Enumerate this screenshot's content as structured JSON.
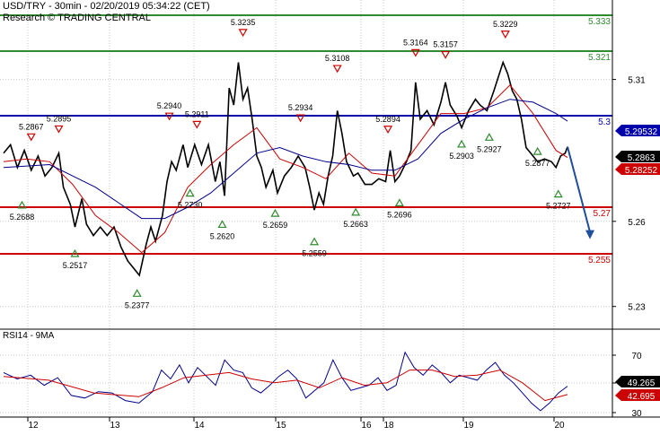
{
  "header": {
    "title": "USD/TRY - 30min - 02/20/2019 05:34:22 (CET)",
    "subtitle": "Research © TRADING CENTRAL"
  },
  "rsi_panel": {
    "title": "RSI14 - 9MA",
    "value": "49.265",
    "ma_value": "42.695",
    "ticks": [
      "70",
      "50",
      "30"
    ]
  },
  "colors": {
    "resistance": "#2e8b2e",
    "pivot": "#0000aa",
    "support": "#cc0000",
    "price": "#000000",
    "ma_fast": "#cc0000",
    "ma_slow": "#00008b",
    "arrow": "#1f4e9c",
    "price_tag": "#000000",
    "pivot_tag": "#0000aa",
    "ma_tag": "#cc0000",
    "rsi_tag": "#000000",
    "rsi_ma_tag": "#cc0000"
  },
  "chart_data": {
    "type": "line",
    "instrument": "USD/TRY",
    "timeframe": "30min",
    "y_axis_ticks": [
      "5.31",
      "5.26",
      "5.23"
    ],
    "ylim": [
      5.222,
      5.338
    ],
    "x_axis_ticks": [
      "12",
      "13",
      "14",
      "15",
      "16",
      "18",
      "19",
      "20"
    ],
    "levels": [
      {
        "kind": "resistance",
        "value": 5.333,
        "label": "5.333"
      },
      {
        "kind": "resistance",
        "value": 5.321,
        "label": "5.321"
      },
      {
        "kind": "pivot",
        "value": 5.3,
        "label": "5.3"
      },
      {
        "kind": "support",
        "value": 5.27,
        "label": "5.27"
      },
      {
        "kind": "support",
        "value": 5.255,
        "label": "5.255"
      }
    ],
    "price_tags": [
      {
        "kind": "pivot",
        "value": "5.29532"
      },
      {
        "kind": "price",
        "value": "5.2863"
      },
      {
        "kind": "ma",
        "value": "5.28252"
      }
    ],
    "annotations": [
      {
        "label": "5.2867",
        "type": "high",
        "x": 0.6,
        "value": 5.2867
      },
      {
        "label": "5.2895",
        "type": "high",
        "x": 1.2,
        "value": 5.2895
      },
      {
        "label": "5.2688",
        "type": "low",
        "x": 0.4,
        "value": 5.2688
      },
      {
        "label": "5.2517",
        "type": "low",
        "x": 1.55,
        "value": 5.2517
      },
      {
        "label": "5.2377",
        "type": "low",
        "x": 2.9,
        "value": 5.2377
      },
      {
        "label": "5.2940",
        "type": "high",
        "x": 3.6,
        "value": 5.294
      },
      {
        "label": "5.2911",
        "type": "high",
        "x": 4.2,
        "value": 5.2911
      },
      {
        "label": "5.2730",
        "type": "low",
        "x": 4.05,
        "value": 5.273
      },
      {
        "label": "5.2620",
        "type": "low",
        "x": 4.75,
        "value": 5.262
      },
      {
        "label": "5.3235",
        "type": "high",
        "x": 5.2,
        "value": 5.3235
      },
      {
        "label": "5.2659",
        "type": "low",
        "x": 5.9,
        "value": 5.2659
      },
      {
        "label": "5.2934",
        "type": "high",
        "x": 6.45,
        "value": 5.2934
      },
      {
        "label": "5.2559",
        "type": "low",
        "x": 6.75,
        "value": 5.2559
      },
      {
        "label": "5.3108",
        "type": "high",
        "x": 7.25,
        "value": 5.3108
      },
      {
        "label": "5.2663",
        "type": "low",
        "x": 7.65,
        "value": 5.2663
      },
      {
        "label": "5.2894",
        "type": "high",
        "x": 8.35,
        "value": 5.2894
      },
      {
        "label": "5.2696",
        "type": "low",
        "x": 8.6,
        "value": 5.2696
      },
      {
        "label": "5.3164",
        "type": "high",
        "x": 8.95,
        "value": 5.3164
      },
      {
        "label": "5.3157",
        "type": "high",
        "x": 9.6,
        "value": 5.3157
      },
      {
        "label": "5.2903",
        "type": "low",
        "x": 9.95,
        "value": 5.2903
      },
      {
        "label": "5.3229",
        "type": "high",
        "x": 10.9,
        "value": 5.3229
      },
      {
        "label": "5.2927",
        "type": "low",
        "x": 10.55,
        "value": 5.2927
      },
      {
        "label": "5.2877",
        "type": "low",
        "x": 11.6,
        "value": 5.2877
      },
      {
        "label": "5.2727",
        "type": "low",
        "x": 12.05,
        "value": 5.2727
      }
    ],
    "forecast_arrow": {
      "from": 5.2863,
      "to": 5.255
    },
    "series": [
      {
        "name": "Price",
        "points": [
          [
            0,
            5.284
          ],
          [
            0.15,
            5.287
          ],
          [
            0.3,
            5.279
          ],
          [
            0.45,
            5.285
          ],
          [
            0.6,
            5.278
          ],
          [
            0.75,
            5.283
          ],
          [
            0.9,
            5.276
          ],
          [
            1.05,
            5.279
          ],
          [
            1.2,
            5.284
          ],
          [
            1.3,
            5.272
          ],
          [
            1.45,
            5.266
          ],
          [
            1.55,
            5.258
          ],
          [
            1.7,
            5.268
          ],
          [
            1.8,
            5.259
          ],
          [
            1.95,
            5.255
          ],
          [
            2.1,
            5.258
          ],
          [
            2.25,
            5.255
          ],
          [
            2.4,
            5.258
          ],
          [
            2.55,
            5.251
          ],
          [
            2.7,
            5.246
          ],
          [
            2.85,
            5.243
          ],
          [
            2.95,
            5.241
          ],
          [
            3.1,
            5.252
          ],
          [
            3.2,
            5.258
          ],
          [
            3.3,
            5.253
          ],
          [
            3.45,
            5.262
          ],
          [
            3.55,
            5.274
          ],
          [
            3.65,
            5.281
          ],
          [
            3.75,
            5.278
          ],
          [
            3.9,
            5.287
          ],
          [
            4.0,
            5.279
          ],
          [
            4.15,
            5.287
          ],
          [
            4.3,
            5.28
          ],
          [
            4.45,
            5.287
          ],
          [
            4.6,
            5.274
          ],
          [
            4.7,
            5.281
          ],
          [
            4.8,
            5.269
          ],
          [
            4.9,
            5.307
          ],
          [
            5.0,
            5.301
          ],
          [
            5.1,
            5.316
          ],
          [
            5.2,
            5.303
          ],
          [
            5.3,
            5.307
          ],
          [
            5.4,
            5.296
          ],
          [
            5.5,
            5.283
          ],
          [
            5.6,
            5.279
          ],
          [
            5.7,
            5.272
          ],
          [
            5.85,
            5.278
          ],
          [
            5.95,
            5.27
          ],
          [
            6.1,
            5.276
          ],
          [
            6.25,
            5.279
          ],
          [
            6.4,
            5.283
          ],
          [
            6.55,
            5.279
          ],
          [
            6.65,
            5.272
          ],
          [
            6.75,
            5.264
          ],
          [
            6.85,
            5.27
          ],
          [
            6.95,
            5.266
          ],
          [
            7.05,
            5.276
          ],
          [
            7.15,
            5.283
          ],
          [
            7.25,
            5.299
          ],
          [
            7.35,
            5.291
          ],
          [
            7.45,
            5.281
          ],
          [
            7.6,
            5.276
          ],
          [
            7.7,
            5.277
          ],
          [
            7.85,
            5.273
          ],
          [
            8.0,
            5.273
          ],
          [
            8.15,
            5.275
          ],
          [
            8.3,
            5.274
          ],
          [
            8.4,
            5.285
          ],
          [
            8.5,
            5.274
          ],
          [
            8.6,
            5.276
          ],
          [
            8.75,
            5.281
          ],
          [
            8.85,
            5.285
          ],
          [
            8.95,
            5.309
          ],
          [
            9.05,
            5.296
          ],
          [
            9.2,
            5.299
          ],
          [
            9.35,
            5.294
          ],
          [
            9.5,
            5.302
          ],
          [
            9.6,
            5.309
          ],
          [
            9.7,
            5.301
          ],
          [
            9.85,
            5.297
          ],
          [
            9.95,
            5.293
          ],
          [
            10.1,
            5.299
          ],
          [
            10.25,
            5.303
          ],
          [
            10.35,
            5.301
          ],
          [
            10.5,
            5.299
          ],
          [
            10.65,
            5.306
          ],
          [
            10.75,
            5.311
          ],
          [
            10.85,
            5.316
          ],
          [
            10.95,
            5.312
          ],
          [
            11.05,
            5.306
          ],
          [
            11.15,
            5.303
          ],
          [
            11.25,
            5.296
          ],
          [
            11.35,
            5.286
          ],
          [
            11.45,
            5.284
          ],
          [
            11.6,
            5.281
          ],
          [
            11.75,
            5.282
          ],
          [
            11.9,
            5.281
          ],
          [
            12.0,
            5.279
          ],
          [
            12.1,
            5.283
          ],
          [
            12.2,
            5.284
          ],
          [
            12.25,
            5.2863
          ]
        ]
      },
      {
        "name": "MA fast",
        "points": [
          [
            0,
            5.281
          ],
          [
            0.5,
            5.282
          ],
          [
            1.0,
            5.281
          ],
          [
            1.5,
            5.273
          ],
          [
            2.0,
            5.262
          ],
          [
            2.5,
            5.256
          ],
          [
            3.0,
            5.249
          ],
          [
            3.5,
            5.256
          ],
          [
            4.0,
            5.272
          ],
          [
            4.5,
            5.28
          ],
          [
            5.0,
            5.287
          ],
          [
            5.5,
            5.293
          ],
          [
            6.0,
            5.282
          ],
          [
            6.5,
            5.279
          ],
          [
            7.0,
            5.275
          ],
          [
            7.5,
            5.284
          ],
          [
            8.0,
            5.277
          ],
          [
            8.5,
            5.276
          ],
          [
            9.0,
            5.287
          ],
          [
            9.5,
            5.298
          ],
          [
            10.0,
            5.298
          ],
          [
            10.5,
            5.3
          ],
          [
            11.0,
            5.308
          ],
          [
            11.5,
            5.298
          ],
          [
            12.0,
            5.285
          ],
          [
            12.25,
            5.2825
          ]
        ]
      },
      {
        "name": "MA slow",
        "points": [
          [
            0,
            5.279
          ],
          [
            1.0,
            5.28
          ],
          [
            2.0,
            5.272
          ],
          [
            3.0,
            5.261
          ],
          [
            3.5,
            5.261
          ],
          [
            4.0,
            5.265
          ],
          [
            4.5,
            5.27
          ],
          [
            5.0,
            5.277
          ],
          [
            5.5,
            5.284
          ],
          [
            6.0,
            5.286
          ],
          [
            6.5,
            5.283
          ],
          [
            7.0,
            5.281
          ],
          [
            7.5,
            5.28
          ],
          [
            8.0,
            5.278
          ],
          [
            8.5,
            5.278
          ],
          [
            9.0,
            5.282
          ],
          [
            9.5,
            5.291
          ],
          [
            10.0,
            5.296
          ],
          [
            10.5,
            5.3
          ],
          [
            11.0,
            5.303
          ],
          [
            11.5,
            5.302
          ],
          [
            12.0,
            5.298
          ],
          [
            12.25,
            5.2953
          ]
        ]
      },
      {
        "name": "RSI14",
        "points": [
          [
            0,
            60
          ],
          [
            0.3,
            55
          ],
          [
            0.6,
            58
          ],
          [
            0.9,
            50
          ],
          [
            1.2,
            56
          ],
          [
            1.5,
            42
          ],
          [
            1.8,
            40
          ],
          [
            2.1,
            45
          ],
          [
            2.4,
            44
          ],
          [
            2.7,
            38
          ],
          [
            3.0,
            36
          ],
          [
            3.3,
            45
          ],
          [
            3.5,
            62
          ],
          [
            3.7,
            55
          ],
          [
            3.9,
            66
          ],
          [
            4.1,
            52
          ],
          [
            4.3,
            64
          ],
          [
            4.5,
            57
          ],
          [
            4.7,
            50
          ],
          [
            4.9,
            70
          ],
          [
            5.1,
            62
          ],
          [
            5.3,
            60
          ],
          [
            5.5,
            48
          ],
          [
            5.7,
            44
          ],
          [
            5.9,
            50
          ],
          [
            6.1,
            57
          ],
          [
            6.3,
            62
          ],
          [
            6.5,
            55
          ],
          [
            6.7,
            40
          ],
          [
            6.9,
            46
          ],
          [
            7.1,
            52
          ],
          [
            7.3,
            70
          ],
          [
            7.5,
            56
          ],
          [
            7.7,
            46
          ],
          [
            7.9,
            48
          ],
          [
            8.1,
            50
          ],
          [
            8.3,
            56
          ],
          [
            8.5,
            46
          ],
          [
            8.7,
            50
          ],
          [
            8.9,
            76
          ],
          [
            9.1,
            64
          ],
          [
            9.3,
            58
          ],
          [
            9.5,
            66
          ],
          [
            9.7,
            60
          ],
          [
            9.9,
            52
          ],
          [
            10.1,
            58
          ],
          [
            10.3,
            56
          ],
          [
            10.5,
            54
          ],
          [
            10.7,
            62
          ],
          [
            10.9,
            68
          ],
          [
            11.1,
            58
          ],
          [
            11.3,
            52
          ],
          [
            11.5,
            44
          ],
          [
            11.7,
            36
          ],
          [
            11.9,
            30
          ],
          [
            12.1,
            36
          ],
          [
            12.3,
            44
          ],
          [
            12.5,
            49.265
          ]
        ]
      },
      {
        "name": "RSI MA",
        "points": [
          [
            0,
            57
          ],
          [
            1.0,
            54
          ],
          [
            2.0,
            44
          ],
          [
            3.0,
            41
          ],
          [
            3.5,
            48
          ],
          [
            4.0,
            56
          ],
          [
            4.5,
            58
          ],
          [
            5.0,
            60
          ],
          [
            5.5,
            55
          ],
          [
            6.0,
            52
          ],
          [
            6.5,
            54
          ],
          [
            7.0,
            48
          ],
          [
            7.5,
            56
          ],
          [
            8.0,
            50
          ],
          [
            8.5,
            52
          ],
          [
            9.0,
            62
          ],
          [
            9.5,
            62
          ],
          [
            10.0,
            57
          ],
          [
            10.5,
            58
          ],
          [
            11.0,
            62
          ],
          [
            11.5,
            52
          ],
          [
            12.0,
            38
          ],
          [
            12.5,
            42.695
          ]
        ]
      }
    ]
  }
}
